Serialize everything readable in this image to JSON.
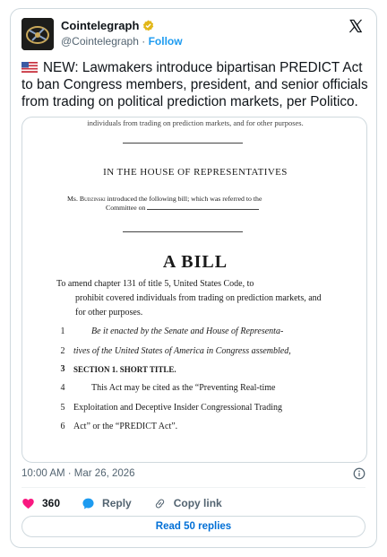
{
  "account": {
    "display_name": "Cointelegraph",
    "handle": "@Cointelegraph",
    "separator": " · ",
    "follow_label": "Follow"
  },
  "tweet": {
    "text": "NEW: Lawmakers introduce bipartisan PREDICT Act to ban Congress members, president, and senior officials from trading on political prediction markets, per Politico.",
    "timestamp": "10:00 AM · Mar 26, 2026"
  },
  "document": {
    "top_fragment": "individuals from trading on prediction markets, and for other purposes.",
    "house": "IN THE HOUSE OF REPRESENTATIVES",
    "intro_line1_a": "Ms. ",
    "intro_member": "Budzinski",
    "intro_line1_b": " introduced the following bill; which was referred to the",
    "intro_line2": "Committee on",
    "title": "A BILL",
    "amend_first": "To amend chapter 131 of title 5, United States Code, to",
    "amend_rest": "prohibit covered individuals from trading on prediction markets, and for other purposes.",
    "lines": [
      {
        "num": "1",
        "text": "Be it enacted by the Senate and House of Representa-"
      },
      {
        "num": "2",
        "text": "tives of the United States of America in Congress assembled,"
      },
      {
        "num": "3",
        "text": "SECTION 1. SHORT TITLE."
      },
      {
        "num": "4",
        "text": "This Act may be cited as the “Preventing Real-time"
      },
      {
        "num": "5",
        "text": "Exploitation and Deceptive Insider Congressional Trading"
      },
      {
        "num": "6",
        "text": "Act” or the “PREDICT Act”."
      }
    ]
  },
  "actions": {
    "like_count": "360",
    "reply_label": "Reply",
    "copy_label": "Copy link"
  },
  "read_replies_label": "Read 50 replies",
  "icons": {
    "verified": "verified-badge-icon",
    "x_logo": "x-logo-icon",
    "flag": "us-flag-icon",
    "info": "info-icon",
    "heart": "heart-icon",
    "reply": "reply-bubble-icon",
    "link": "link-icon"
  },
  "colors": {
    "accent": "#1d9bf0",
    "heart": "#f91880",
    "link_text": "#006fd6",
    "muted": "#536471",
    "border": "#cfd9de",
    "verified_gold": "#e2b719"
  }
}
